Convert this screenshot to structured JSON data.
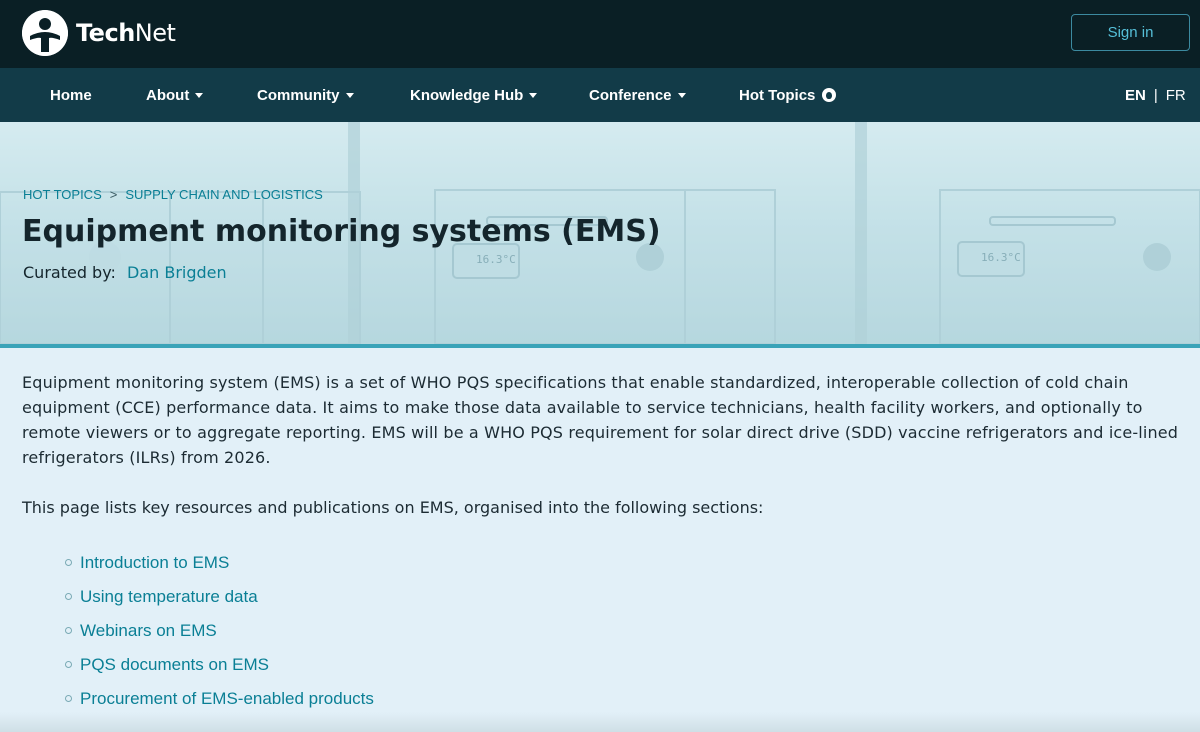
{
  "header": {
    "logo_bold": "Tech",
    "logo_regular": "Net",
    "sign_in_label": "Sign in"
  },
  "nav": {
    "items": [
      {
        "label": "Home"
      },
      {
        "label": "About"
      },
      {
        "label": "Community"
      },
      {
        "label": "Knowledge Hub"
      },
      {
        "label": "Conference"
      },
      {
        "label": "Hot Topics"
      }
    ],
    "lang_en": "EN",
    "lang_sep": "|",
    "lang_fr": "FR"
  },
  "breadcrumb": {
    "items": [
      "HOT TOPICS",
      "SUPPLY CHAIN AND LOGISTICS"
    ],
    "separator": ">"
  },
  "page": {
    "title": "Equipment monitoring systems (EMS)",
    "curated_label": "Curated by:",
    "curator": "Dan Brigden",
    "intro": "Equipment monitoring system (EMS) is a set of WHO PQS specifications that enable standardized, interoperable collection of cold chain equipment (CCE) performance data. It aims to make those data available to service technicians, health facility workers, and optionally to remote viewers or to aggregate reporting. EMS will be a WHO PQS requirement for solar direct drive (SDD) vaccine refrigerators and ice-lined refrigerators (ILRs) from 2026.",
    "lead": "This page lists key resources and publications on EMS, organised into the following sections:",
    "sections": [
      "Introduction to EMS",
      "Using temperature data",
      "Webinars on EMS",
      "PQS documents on EMS",
      "Procurement of EMS-enabled products"
    ]
  },
  "hero_display": {
    "fridge_reading": "16.3°C"
  },
  "colors": {
    "topbar": "#0a1f25",
    "navbar": "#123b48",
    "accent": "#0a7f95",
    "page_bg": "#e2f0f8"
  },
  "icons": {
    "logo": "person-in-circle-icon",
    "dropdown": "caret-down-icon",
    "hot_topics": "flame-icon"
  }
}
